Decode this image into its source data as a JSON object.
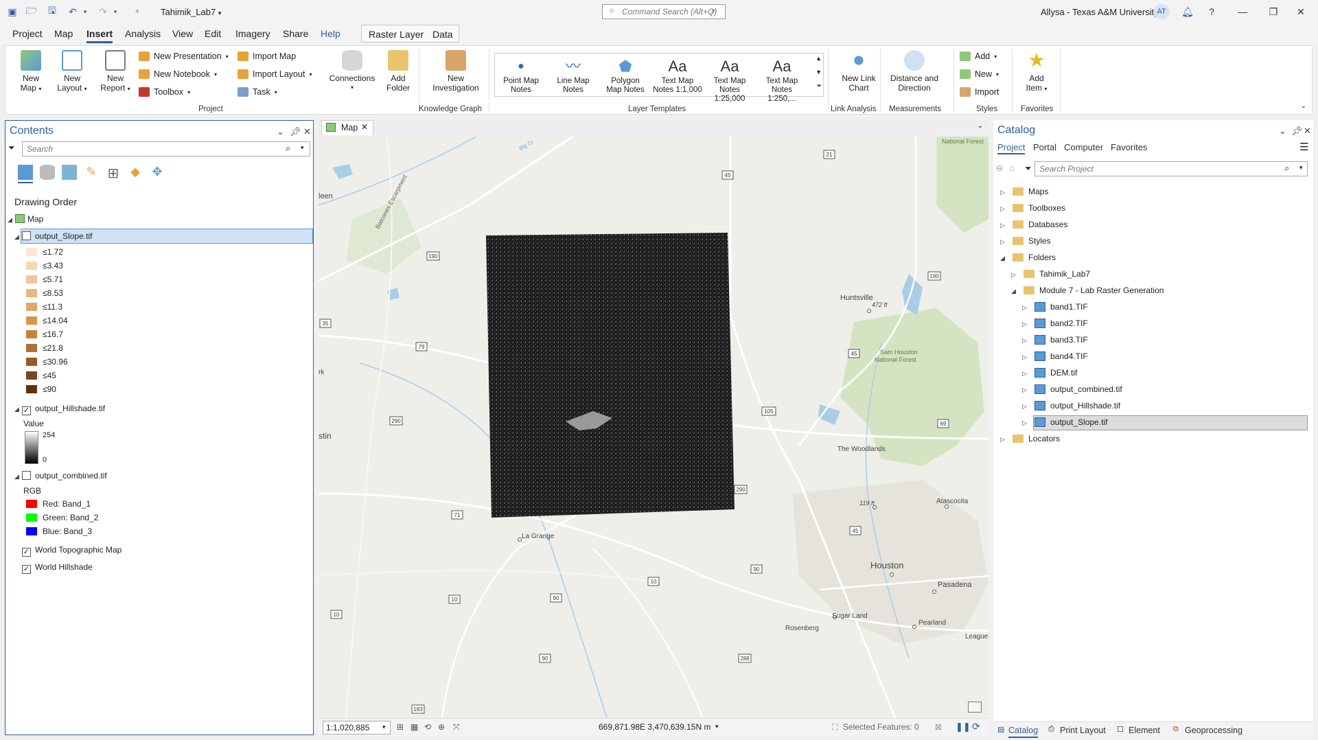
{
  "titlebar": {
    "project_name": "Tahimik_Lab7",
    "command_search_placeholder": "Command Search (Alt+Q)",
    "user": "Allysa - Texas A&M University",
    "avatar_initials": "AT",
    "help": "?"
  },
  "menu": {
    "tabs": [
      "Project",
      "Map",
      "Insert",
      "Analysis",
      "View",
      "Edit",
      "Imagery",
      "Share",
      "Help"
    ],
    "active": "Insert",
    "contextual_tabs": [
      "Raster Layer",
      "Data"
    ]
  },
  "ribbon": {
    "project_group": {
      "label": "Project",
      "new_map": [
        "New",
        "Map"
      ],
      "new_layout": [
        "New",
        "Layout"
      ],
      "new_report": [
        "New",
        "Report"
      ],
      "new_presentation": "New Presentation",
      "new_notebook": "New Notebook",
      "toolbox": "Toolbox",
      "import_map": "Import Map",
      "import_layout": "Import Layout",
      "task": "Task",
      "connections": "Connections",
      "add_folder": [
        "Add",
        "Folder"
      ]
    },
    "knowledge_graph": {
      "label": "Knowledge Graph",
      "new_investigation": [
        "New",
        "Investigation"
      ]
    },
    "layer_templates": {
      "label": "Layer Templates",
      "items": [
        {
          "l1": "Point Map",
          "l2": "Notes"
        },
        {
          "l1": "Line Map",
          "l2": "Notes"
        },
        {
          "l1": "Polygon",
          "l2": "Map Notes"
        },
        {
          "l1": "Text Map",
          "l2": "Notes 1:1,000"
        },
        {
          "l1": "Text Map",
          "l2": "Notes 1:25,000"
        },
        {
          "l1": "Text Map",
          "l2": "Notes 1:250,..."
        }
      ],
      "aa": "Aa"
    },
    "link_analysis": {
      "label": "Link Analysis",
      "new_link_chart": [
        "New Link",
        "Chart"
      ]
    },
    "measurements": {
      "label": "Measurements",
      "distance_direction": [
        "Distance and",
        "Direction"
      ]
    },
    "styles": {
      "label": "Styles",
      "add": "Add",
      "new": "New",
      "import": "Import"
    },
    "favorites": {
      "label": "Favorites",
      "add_item": [
        "Add",
        "Item"
      ]
    }
  },
  "contents": {
    "title": "Contents",
    "search_placeholder": "Search",
    "drawing_order": "Drawing Order",
    "map_name": "Map",
    "slope_layer": "output_Slope.tif",
    "slope_classes": [
      "≤1.72",
      "≤3.43",
      "≤5.71",
      "≤8.53",
      "≤11.3",
      "≤14.04",
      "≤16.7",
      "≤21.8",
      "≤30.96",
      "≤45",
      "≤90"
    ],
    "slope_colors": [
      "#fbe5d6",
      "#f5d7b9",
      "#efc79b",
      "#e9b77e",
      "#e2a762",
      "#d9944b",
      "#c9823c",
      "#b27032",
      "#955b26",
      "#78471c",
      "#5b3513"
    ],
    "hillshade_layer": "output_Hillshade.tif",
    "value_label": "Value",
    "value_max": "254",
    "value_min": "0",
    "combined_layer": "output_combined.tif",
    "rgb_label": "RGB",
    "bands": [
      {
        "label": "Red:   Band_1",
        "color": "#ff0000"
      },
      {
        "label": "Green: Band_2",
        "color": "#00ff00"
      },
      {
        "label": "Blue:  Band_3",
        "color": "#0000ff"
      }
    ],
    "world_topo": "World Topographic Map",
    "world_hillshade": "World Hillshade"
  },
  "map": {
    "tab_label": "Map",
    "labels": {
      "killeen": "leen",
      "austin": "stin",
      "park": "rk",
      "balcones": "Balcones Escarpment",
      "huntsville": "Huntsville",
      "elev1": "472 ft",
      "sam_houston": "Sam Houston",
      "national_forest": "National Forest",
      "top_nf": "National Forest",
      "woodlands": "The Woodlands",
      "elev2": "119 ft",
      "atascocita": "Atascocita",
      "houston": "Houston",
      "pasadena": "Pasadena",
      "sugar_land": "Sugar Land",
      "pearland": "Pearland",
      "rosenberg": "Rosenberg",
      "league": "League",
      "la_grange": "La Grange",
      "big_creek": "Big Cr"
    },
    "shields": [
      "21",
      "45",
      "190",
      "190",
      "35",
      "79",
      "45",
      "105",
      "290",
      "69",
      "290",
      "71",
      "45",
      "90",
      "10",
      "90",
      "10",
      "10",
      "90",
      "288",
      "183"
    ]
  },
  "status": {
    "scale": "1:1,020,885",
    "coords": "669,871.98E 3,470,639.15N m",
    "selected": "Selected Features: 0"
  },
  "catalog": {
    "title": "Catalog",
    "tabs": [
      "Project",
      "Portal",
      "Computer",
      "Favorites"
    ],
    "search_placeholder": "Search Project",
    "items": [
      {
        "label": "Maps",
        "indent": 0
      },
      {
        "label": "Toolboxes",
        "indent": 0
      },
      {
        "label": "Databases",
        "indent": 0
      },
      {
        "label": "Styles",
        "indent": 0
      },
      {
        "label": "Folders",
        "indent": 0
      },
      {
        "label": "Tahimik_Lab7",
        "indent": 1
      },
      {
        "label": "Module 7 - Lab Raster Generation",
        "indent": 1
      },
      {
        "label": "band1.TIF",
        "indent": 2
      },
      {
        "label": "band2.TIF",
        "indent": 2
      },
      {
        "label": "band3.TIF",
        "indent": 2
      },
      {
        "label": "band4.TIF",
        "indent": 2
      },
      {
        "label": "DEM.tif",
        "indent": 2
      },
      {
        "label": "output_combined.tif",
        "indent": 2
      },
      {
        "label": "output_Hillshade.tif",
        "indent": 2
      },
      {
        "label": "output_Slope.tif",
        "indent": 2
      },
      {
        "label": "Locators",
        "indent": 0
      }
    ],
    "bottom_tabs": [
      "Catalog",
      "Print Layout",
      "Element",
      "Geoprocessing"
    ]
  }
}
